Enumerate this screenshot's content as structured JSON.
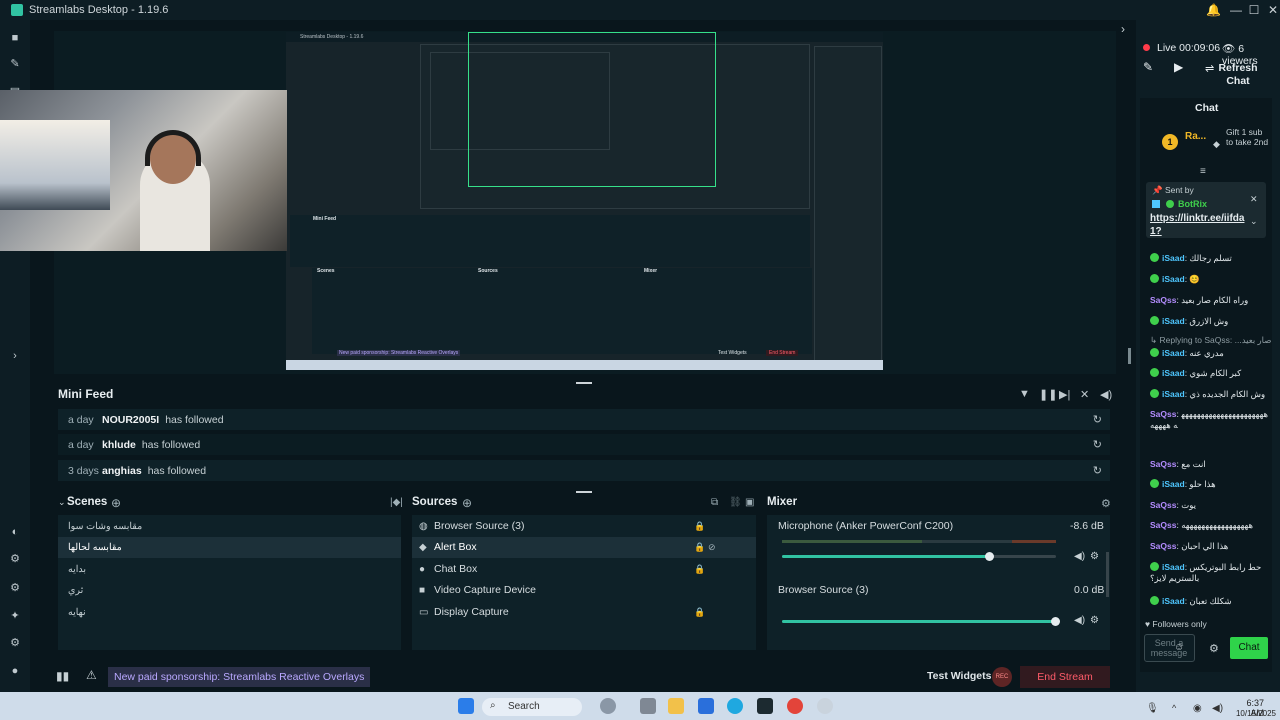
{
  "window": {
    "title": "Streamlabs Desktop - 1.19.6",
    "min": "—",
    "max": "☐",
    "close": "✕",
    "bell": "🔔"
  },
  "editor": {
    "nested_title": "Streamlabs Desktop - 1.19.6",
    "nested_mini_feed": "Mini Feed",
    "nested_promo": "New paid sponsorship: Streamlabs Reactive Overlays",
    "nested_test_widgets": "Test Widgets",
    "nested_end_stream": "End Stream",
    "nested_scenes": "Scenes",
    "nested_sources": "Sources",
    "nested_mixer": "Mixer"
  },
  "mini_feed": {
    "title": "Mini Feed",
    "events": [
      {
        "ago": "a day",
        "name": "NOUR2005I",
        "action": "has followed"
      },
      {
        "ago": "a day",
        "name": "khlude",
        "action": "has followed"
      },
      {
        "ago": "3 days",
        "name": "anghias",
        "action": "has followed"
      }
    ]
  },
  "scenes": {
    "title": "Scenes",
    "items": [
      "مقابسه وشات سوا",
      "مقابسه لحالها",
      "بدايه",
      "ثري",
      "نهايه"
    ],
    "selected": 1
  },
  "sources": {
    "title": "Sources",
    "items": [
      {
        "label": "Browser Source (3)",
        "icon": "globe-icon"
      },
      {
        "label": "Alert Box",
        "icon": "bell-icon"
      },
      {
        "label": "Chat Box",
        "icon": "chat-icon"
      },
      {
        "label": "Video Capture Device",
        "icon": "camera-icon"
      },
      {
        "label": "Display Capture",
        "icon": "monitor-icon"
      }
    ],
    "selected": 1
  },
  "mixer": {
    "title": "Mixer",
    "channels": [
      {
        "name": "Microphone (Anker PowerConf C200)",
        "db": "-8.6 dB",
        "level": 0.76
      },
      {
        "name": "Browser Source (3)",
        "db": "0.0 dB",
        "level": 1.0
      }
    ]
  },
  "footer": {
    "promo": "New paid sponsorship: Streamlabs Reactive Overlays",
    "test_widgets": "Test Widgets",
    "rec_label": "REC",
    "end_stream": "End Stream"
  },
  "chat": {
    "live": "Live 00:09:06",
    "viewers": "6 viewers",
    "refresh": "Refresh Chat",
    "title": "Chat",
    "gift_user": "Ra...",
    "gift_count": "1",
    "gift_text": "Gift 1 sub to take 2nd",
    "pinned_by": "Sent by",
    "pinned_user": "BotRix",
    "pinned_link": "https://linktr.ee/iifda1?",
    "messages": [
      {
        "user": "iSaad",
        "text": "تسلم رجالك",
        "type": "u"
      },
      {
        "user": "iSaad",
        "text": "😊",
        "type": "u"
      },
      {
        "user": "SaQss",
        "text": "وراه الكام صار بعيد",
        "type": "p"
      },
      {
        "user": "iSaad",
        "text": "وش الازرق",
        "type": "u"
      },
      {
        "user": "",
        "text": "Replying to SaQss: ...وراه الكام صار بعيد",
        "type": "reply"
      },
      {
        "user": "iSaad",
        "text": "مدري عنه",
        "type": "u"
      },
      {
        "user": "iSaad",
        "text": "كبر الكام شوي",
        "type": "u"
      },
      {
        "user": "iSaad",
        "text": "وش الكام الجديده ذي",
        "type": "u"
      },
      {
        "user": "SaQss",
        "text": "ههههههههههههههههههههههه ههههه",
        "type": "p"
      },
      {
        "user": "SaQss",
        "text": "انت مع",
        "type": "p"
      },
      {
        "user": "iSaad",
        "text": "هذا حلو",
        "type": "u"
      },
      {
        "user": "SaQss",
        "text": "يوت",
        "type": "p"
      },
      {
        "user": "SaQss",
        "text": "هههههههههههههههههه",
        "type": "p"
      },
      {
        "user": "SaQss",
        "text": "هذا الي احبان",
        "type": "p"
      },
      {
        "user": "iSaad",
        "text": "حط رابط البوتريكس بالستريم لايز؟",
        "type": "u"
      },
      {
        "user": "iSaad",
        "text": "شكلك تعبان",
        "type": "u"
      }
    ],
    "followers_only": "Followers only",
    "input_placeholder": "Send a message",
    "send_button": "Chat"
  },
  "taskbar": {
    "search": "Search",
    "time": "6:37 AM",
    "date": "10/15/2025"
  },
  "colors": {
    "accent": "#31c3a2",
    "chat_button": "#2fd34a",
    "end_stream": "#ff5c6a"
  }
}
